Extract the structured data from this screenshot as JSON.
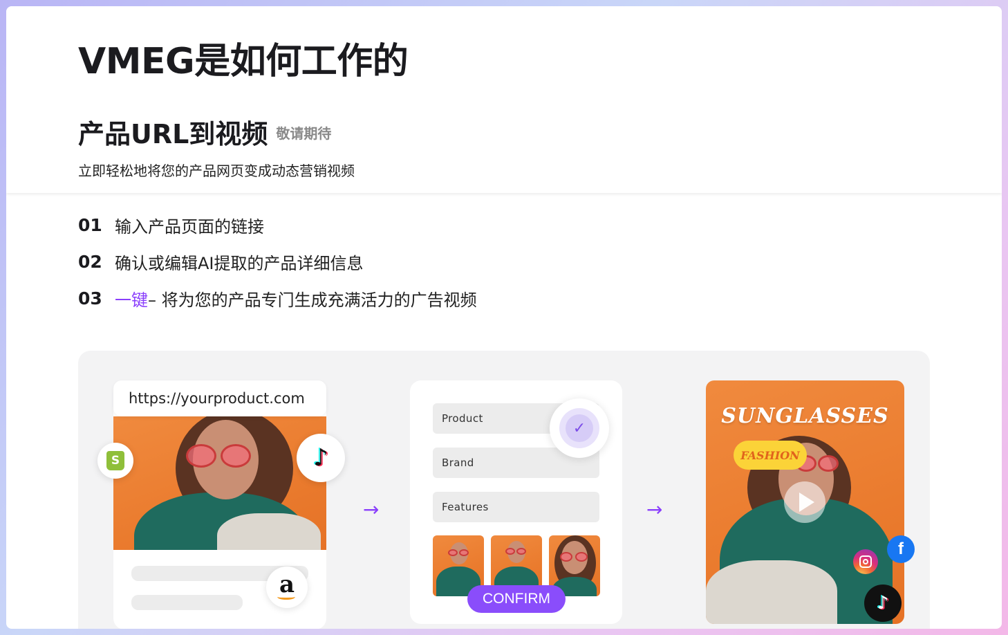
{
  "page": {
    "title": "VMEG是如何工作的",
    "section_title": "产品URL到视频",
    "coming_soon": "敬请期待",
    "subtitle": "立即轻松地将您的产品网页变成动态营销视频"
  },
  "steps": [
    {
      "num": "01",
      "highlight": "",
      "text": "输入产品页面的链接"
    },
    {
      "num": "02",
      "highlight": "",
      "text": "确认或编辑AI提取的产品详细信息"
    },
    {
      "num": "03",
      "highlight": "一键",
      "text": " – 将为您的产品专门生成充满活力的广告视频"
    }
  ],
  "demo": {
    "url": "https://yourproduct.com",
    "fields": [
      "Product",
      "Brand",
      "Features"
    ],
    "confirm_label": "CONFIRM",
    "video_title": "SUNGLASSES",
    "video_tag": "FASHION",
    "icons": {
      "shopify": "shopify-icon",
      "tiktok": "tiktok-icon",
      "amazon": "amazon-icon",
      "check": "check-icon",
      "play": "play-icon",
      "instagram": "instagram-icon",
      "facebook": "facebook-icon",
      "arrow": "arrow-right-icon"
    }
  },
  "colors": {
    "accent": "#8a3ffc",
    "confirm": "#8a4dfb",
    "photo_orange": "#ea7b2e",
    "tag_yellow": "#fbd338",
    "facebook": "#1877f2"
  }
}
